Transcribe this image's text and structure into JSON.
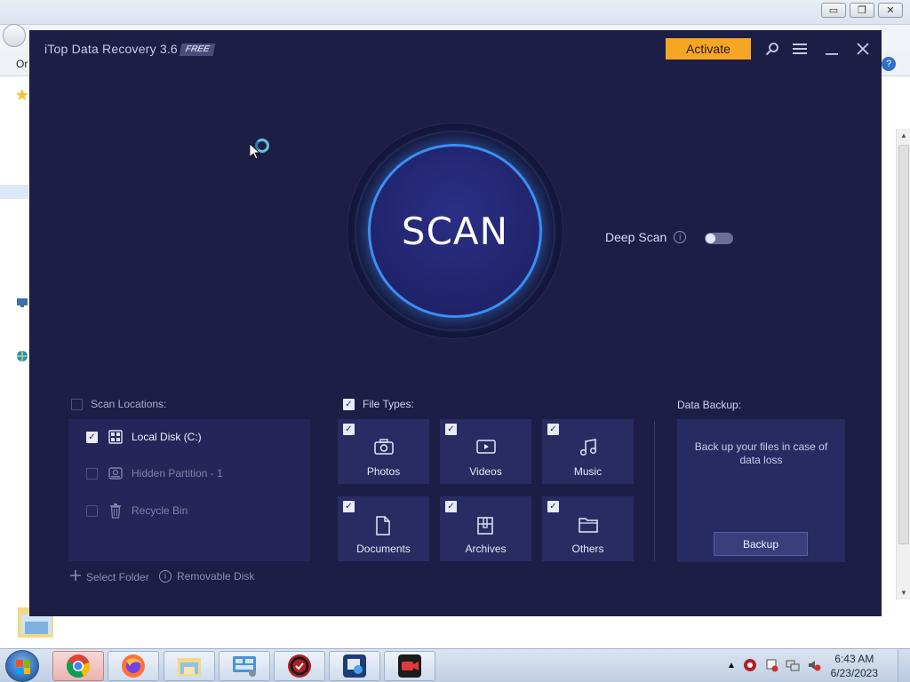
{
  "background": {
    "menu_text": "Or",
    "help": "?"
  },
  "app": {
    "title": "iTop Data Recovery 3.6",
    "badge": "FREE",
    "activate_label": "Activate",
    "scan_label": "SCAN",
    "deep_scan": {
      "label": "Deep Scan",
      "enabled": false
    }
  },
  "scan_locations": {
    "header": "Scan Locations:",
    "checked": false,
    "items": [
      {
        "label": "Local Disk (C:)",
        "checked": true,
        "icon": "drive-icon"
      },
      {
        "label": "Hidden Partition - 1",
        "checked": false,
        "icon": "hidden-drive-icon"
      },
      {
        "label": "Recycle Bin",
        "checked": false,
        "icon": "trash-icon"
      }
    ],
    "select_folder": "Select Folder",
    "removable_disk": "Removable Disk"
  },
  "file_types": {
    "header": "File Types:",
    "checked": true,
    "items": [
      {
        "label": "Photos",
        "checked": true,
        "icon": "camera-icon"
      },
      {
        "label": "Videos",
        "checked": true,
        "icon": "video-icon"
      },
      {
        "label": "Music",
        "checked": true,
        "icon": "music-icon"
      },
      {
        "label": "Documents",
        "checked": true,
        "icon": "document-icon"
      },
      {
        "label": "Archives",
        "checked": true,
        "icon": "archive-icon"
      },
      {
        "label": "Others",
        "checked": true,
        "icon": "folder-icon"
      }
    ]
  },
  "data_backup": {
    "header": "Data Backup:",
    "description": "Back up your files in case of data loss",
    "button": "Backup"
  },
  "taskbar": {
    "apps": [
      "chrome",
      "firefox",
      "file-explorer",
      "control-panel",
      "itop-data-recovery",
      "image-viewer",
      "screen-recorder"
    ],
    "time": "6:43 AM",
    "date": "6/23/2023"
  },
  "colors": {
    "app_bg": "#1d1e45",
    "accent": "#f5a623",
    "scan_ring": "#3a8ff5",
    "tile_bg": "#292c63"
  }
}
